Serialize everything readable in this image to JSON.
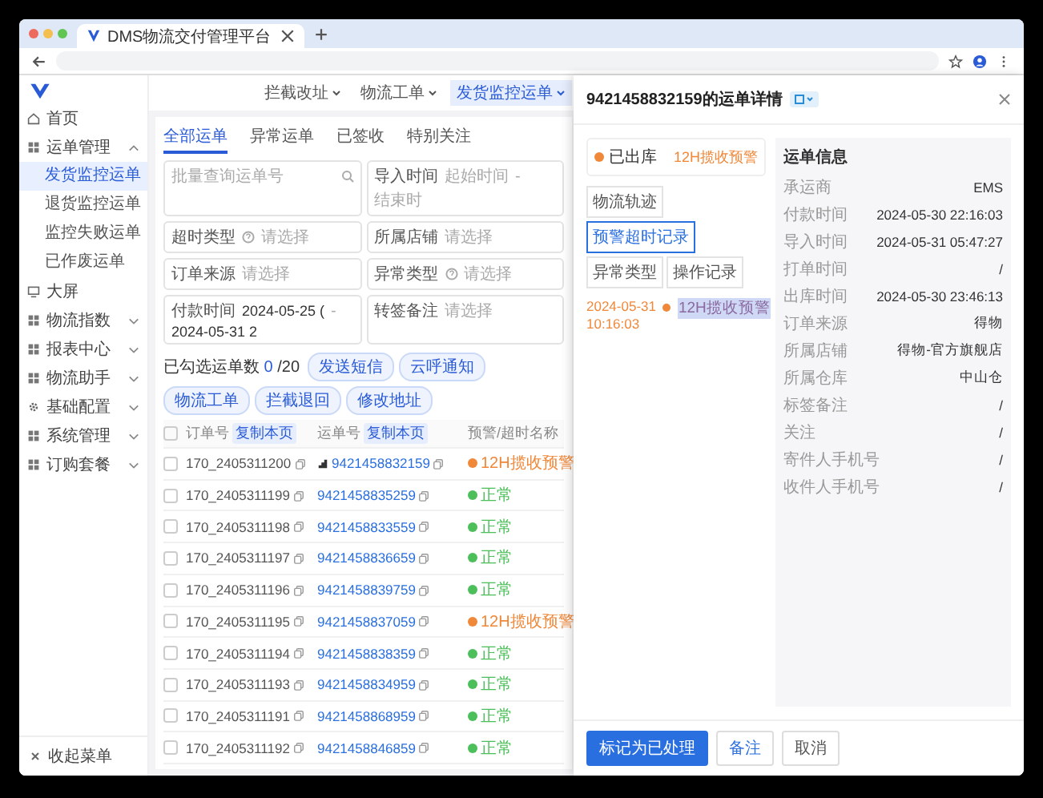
{
  "browser": {
    "tab_title": "DMS物流交付管理平台"
  },
  "sidebar": {
    "items": [
      {
        "label": "首页"
      },
      {
        "label": "运单管理",
        "expanded": true,
        "children": [
          {
            "label": "发货监控运单",
            "selected": true
          },
          {
            "label": "退货监控运单",
            "selected": false
          },
          {
            "label": "监控失败运单",
            "selected": false
          },
          {
            "label": "已作废运单",
            "selected": false
          }
        ]
      },
      {
        "label": "大屏"
      },
      {
        "label": "物流指数",
        "expanded": false
      },
      {
        "label": "报表中心",
        "expanded": false
      },
      {
        "label": "物流助手",
        "expanded": false
      },
      {
        "label": "基础配置",
        "expanded": false
      },
      {
        "label": "系统管理",
        "expanded": false
      },
      {
        "label": "订购套餐",
        "expanded": false
      }
    ],
    "collapse_label": "收起菜单"
  },
  "page_tabs": [
    {
      "label": "拦截改址",
      "selected": false
    },
    {
      "label": "物流工单",
      "selected": false
    },
    {
      "label": "发货监控运单",
      "selected": true
    }
  ],
  "sub_tabs": [
    {
      "label": "全部运单",
      "selected": true
    },
    {
      "label": "异常运单",
      "selected": false
    },
    {
      "label": "已签收",
      "selected": false
    },
    {
      "label": "特别关注",
      "selected": false
    }
  ],
  "filters": [
    {
      "kind": "search",
      "placeholder": "批量查询运单号"
    },
    {
      "kind": "range",
      "label": "导入时间",
      "from": "起始时间",
      "separator": "-",
      "to": "结束时"
    },
    {
      "kind": "select",
      "label": "超时类型",
      "help": true,
      "placeholder": "请选择"
    },
    {
      "kind": "select",
      "label": "所属店铺",
      "placeholder": "请选择"
    },
    {
      "kind": "select",
      "label": "订单来源",
      "placeholder": "请选择"
    },
    {
      "kind": "select",
      "label": "异常类型",
      "help": true,
      "placeholder": "请选择"
    },
    {
      "kind": "daterange",
      "label": "付款时间",
      "from": "2024-05-25 (",
      "separator": "-",
      "to": "2024-05-31 2"
    },
    {
      "kind": "select",
      "label": "转签备注",
      "placeholder": "请选择"
    }
  ],
  "selection": {
    "label": "已勾选运单数",
    "count": "0",
    "total": "/20"
  },
  "actions": [
    "发送短信",
    "云呼通知",
    "物流工单",
    "拦截退回",
    "修改地址"
  ],
  "table": {
    "all_checked": false,
    "columns": [
      {
        "label": "订单号",
        "copy": "复制本页"
      },
      {
        "label": "运单号",
        "copy": "复制本页"
      },
      {
        "label": "预警/超时名称"
      }
    ],
    "rows": [
      {
        "order": "170_2405311200",
        "waybill": "9421458832159",
        "checked": false,
        "marked": true,
        "status": "12H揽收预警",
        "color": "#f0883a"
      },
      {
        "order": "170_2405311199",
        "waybill": "9421458835259",
        "checked": false,
        "marked": false,
        "status": "正常",
        "color": "#4cbf5a"
      },
      {
        "order": "170_2405311198",
        "waybill": "9421458833559",
        "checked": false,
        "marked": false,
        "status": "正常",
        "color": "#4cbf5a"
      },
      {
        "order": "170_2405311197",
        "waybill": "9421458836659",
        "checked": false,
        "marked": false,
        "status": "正常",
        "color": "#4cbf5a"
      },
      {
        "order": "170_2405311196",
        "waybill": "9421458839759",
        "checked": false,
        "marked": false,
        "status": "正常",
        "color": "#4cbf5a"
      },
      {
        "order": "170_2405311195",
        "waybill": "9421458837059",
        "checked": false,
        "marked": false,
        "status": "12H揽收预警",
        "color": "#f0883a"
      },
      {
        "order": "170_2405311194",
        "waybill": "9421458838359",
        "checked": false,
        "marked": false,
        "status": "正常",
        "color": "#4cbf5a"
      },
      {
        "order": "170_2405311193",
        "waybill": "9421458834959",
        "checked": false,
        "marked": false,
        "status": "正常",
        "color": "#4cbf5a"
      },
      {
        "order": "170_2405311191",
        "waybill": "9421458868959",
        "checked": false,
        "marked": false,
        "status": "正常",
        "color": "#4cbf5a"
      },
      {
        "order": "170_2405311192",
        "waybill": "9421458846859",
        "checked": false,
        "marked": false,
        "status": "正常",
        "color": "#4cbf5a"
      }
    ]
  },
  "drawer": {
    "title": "9421458832159的运单详情",
    "status": {
      "label": "已出库",
      "alert": "12H揽收预警"
    },
    "tabs": [
      {
        "label": "物流轨迹",
        "selected": false
      },
      {
        "label": "预警超时记录",
        "selected": true
      },
      {
        "label": "异常类型",
        "selected": false
      },
      {
        "label": "操作记录",
        "selected": false
      }
    ],
    "records": [
      {
        "date": "2024-05-31",
        "time": "10:16:03",
        "text": "12H揽收预警"
      }
    ],
    "info_title": "运单信息",
    "info": [
      {
        "label": "承运商",
        "value": "EMS"
      },
      {
        "label": "付款时间",
        "value": "2024-05-30 22:16:03"
      },
      {
        "label": "导入时间",
        "value": "2024-05-31 05:47:27"
      },
      {
        "label": "打单时间",
        "value": "/"
      },
      {
        "label": "出库时间",
        "value": "2024-05-30 23:46:13"
      },
      {
        "label": "订单来源",
        "value": "得物"
      },
      {
        "label": "所属店铺",
        "value": "得物-官方旗舰店"
      },
      {
        "label": "所属仓库",
        "value": "中山仓"
      },
      {
        "label": "标签备注",
        "value": "/"
      },
      {
        "label": "关注",
        "value": "/"
      },
      {
        "label": "寄件人手机号",
        "value": "/"
      },
      {
        "label": "收件人手机号",
        "value": "/"
      }
    ],
    "buttons": [
      {
        "label": "标记为已处理",
        "kind": "primary"
      },
      {
        "label": "备注",
        "kind": "default"
      },
      {
        "label": "取消",
        "kind": "plain"
      }
    ]
  }
}
